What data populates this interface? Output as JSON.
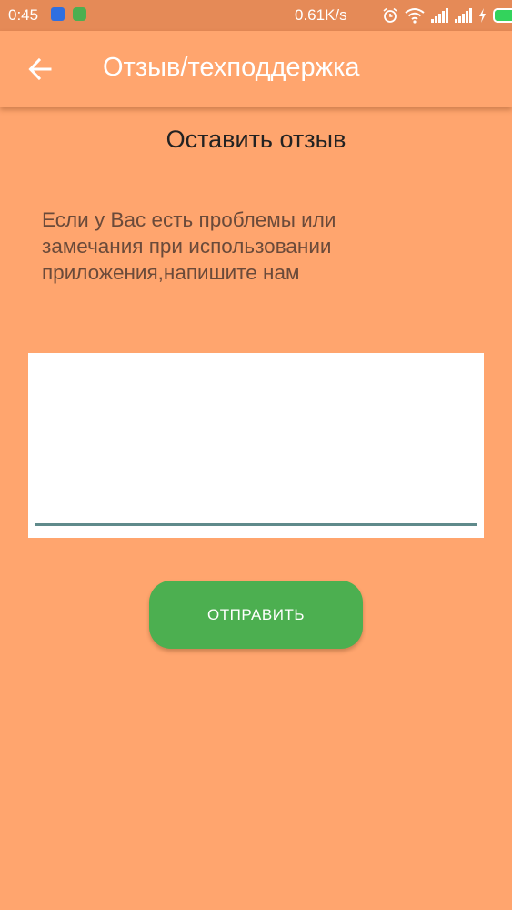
{
  "status_bar": {
    "time": "0:45",
    "net_speed": "0.61K/s",
    "icons": [
      "app-notification-icon",
      "chat-notification-icon",
      "alarm-icon",
      "wifi-icon",
      "signal-icon",
      "signal-icon",
      "charging-icon",
      "battery-icon"
    ]
  },
  "app_bar": {
    "back_icon": "arrow-back-icon",
    "title": "Отзыв/техподдержка"
  },
  "main": {
    "heading": "Оставить отзыв",
    "info_text": "Если у Вас есть проблемы или замечания при использовании приложения,напишите нам",
    "feedback_value": "",
    "send_label": "ОТПРАВИТЬ"
  },
  "colors": {
    "background": "#FFA56E",
    "status_bar": "#E58A57",
    "button": "#4CAF50",
    "input_underline": "#5f8a8b"
  }
}
